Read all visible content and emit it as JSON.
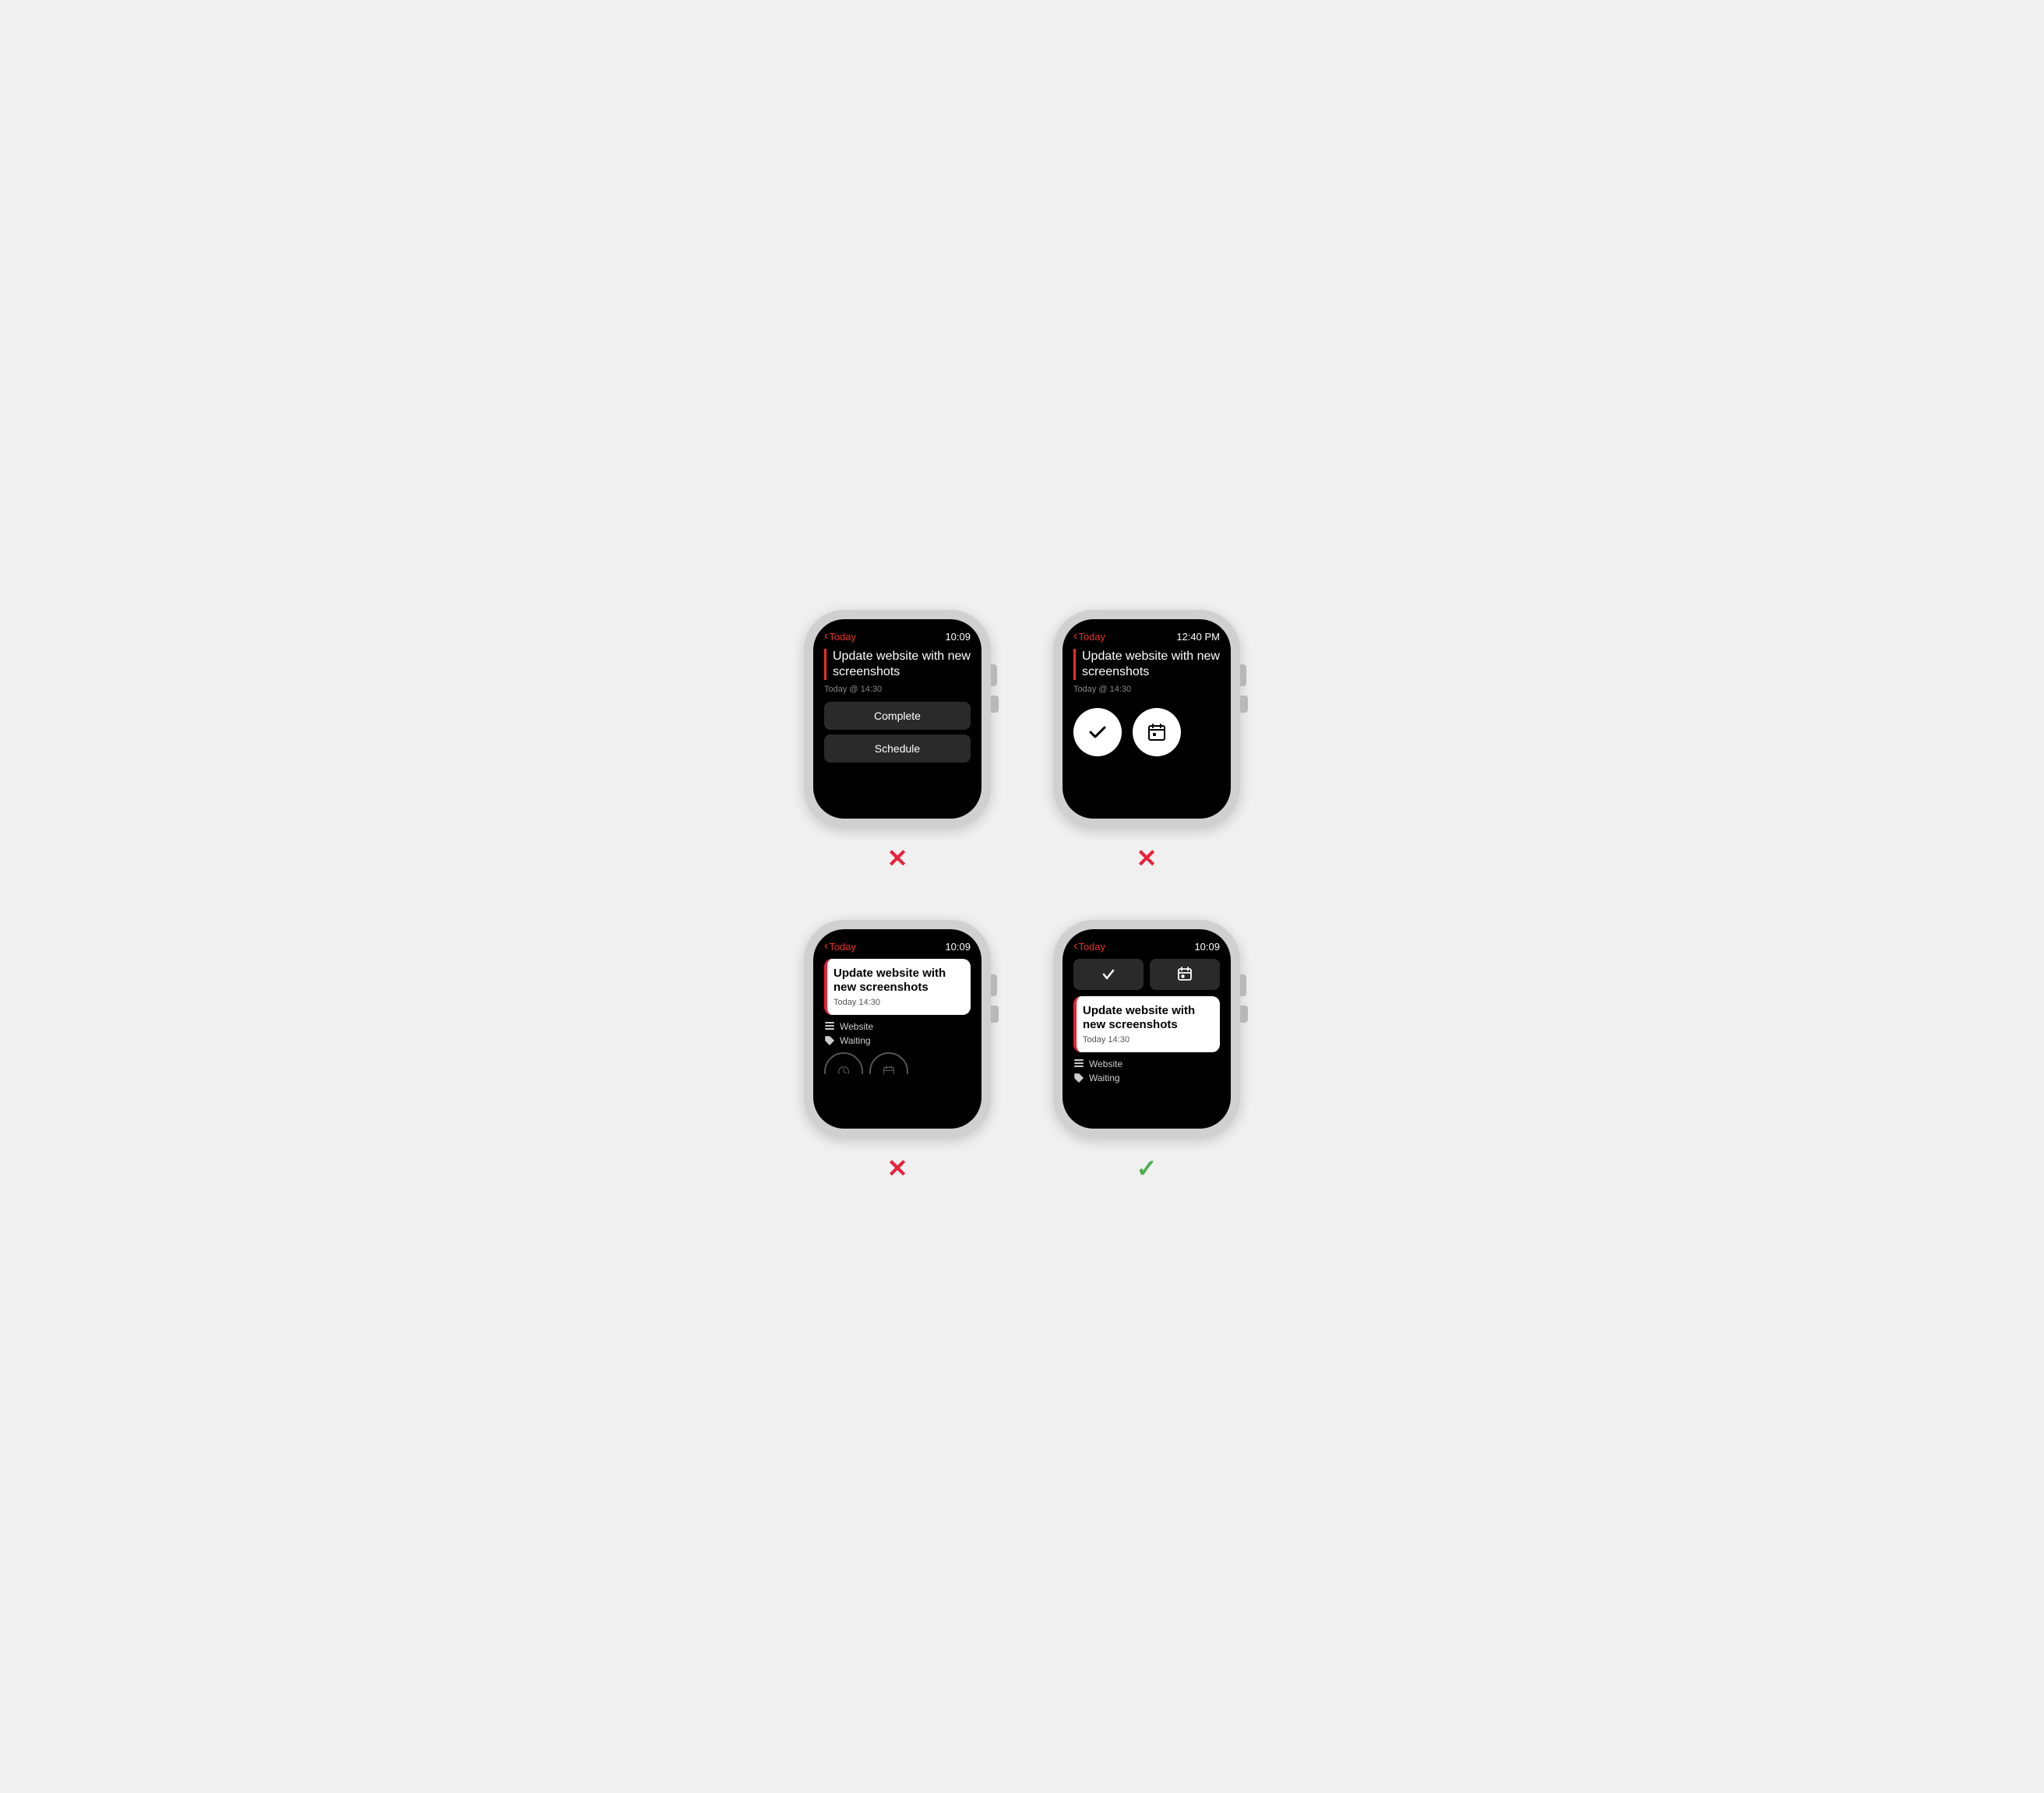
{
  "watches": [
    {
      "id": "top-left",
      "header": {
        "back": "Today",
        "time": "10:09"
      },
      "task": {
        "title": "Update website with new screenshots",
        "due": "Today @ 14:30"
      },
      "buttons": [
        "Complete",
        "Schedule"
      ],
      "result": "x"
    },
    {
      "id": "top-right",
      "header": {
        "back": "Today",
        "time": "12:40 PM"
      },
      "task": {
        "title": "Update website with new screenshots",
        "due": "Today @ 14:30"
      },
      "circles": [
        "checkmark",
        "calendar"
      ],
      "result": "x"
    },
    {
      "id": "bottom-left",
      "header": {
        "back": "Today",
        "time": "10:09"
      },
      "card": {
        "title": "Update website with new screenshots",
        "time": "Today 14:30"
      },
      "meta": [
        "Website",
        "Waiting"
      ],
      "result": "x"
    },
    {
      "id": "bottom-right",
      "header": {
        "back": "Today",
        "time": "10:09"
      },
      "actions": [
        "checkmark",
        "calendar"
      ],
      "card": {
        "title": "Update website with new screenshots",
        "time": "Today 14:30"
      },
      "meta": [
        "Website",
        "Waiting"
      ],
      "result": "check"
    }
  ],
  "labels": {
    "back": "Today",
    "complete": "Complete",
    "schedule": "Schedule",
    "task_title": "Update website with new screenshots",
    "task_due_1": "Today @ 14:30",
    "task_due_2": "Today 14:30",
    "meta_1": "Website",
    "meta_2": "Waiting"
  }
}
